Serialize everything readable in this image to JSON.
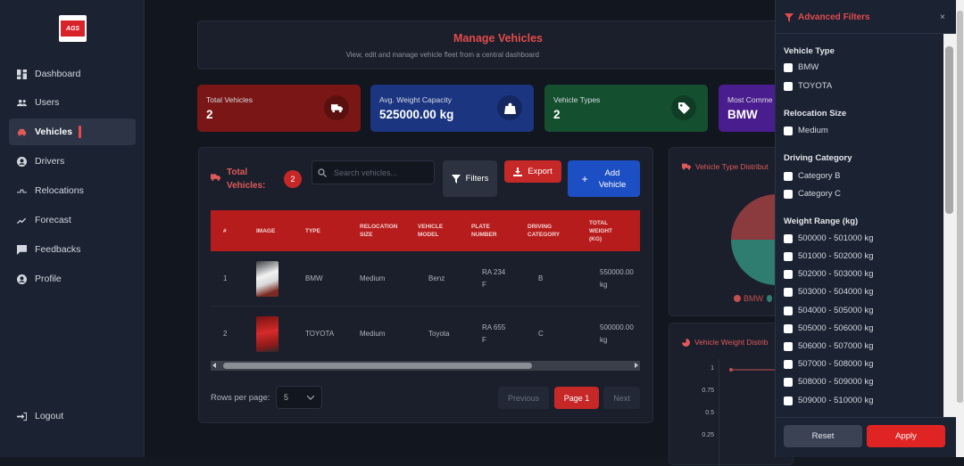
{
  "brand": {
    "logo_text": "AGS"
  },
  "sidebar": {
    "items": [
      {
        "label": "Dashboard",
        "icon": "dashboard-icon"
      },
      {
        "label": "Users",
        "icon": "users-icon"
      },
      {
        "label": "Vehicles",
        "icon": "car-icon"
      },
      {
        "label": "Drivers",
        "icon": "user-circle-icon"
      },
      {
        "label": "Relocations",
        "icon": "route-icon"
      },
      {
        "label": "Forecast",
        "icon": "trend-icon"
      },
      {
        "label": "Feedbacks",
        "icon": "comment-icon"
      },
      {
        "label": "Profile",
        "icon": "profile-icon"
      }
    ],
    "logout": "Logout"
  },
  "header": {
    "title": "Manage Vehicles",
    "subtitle": "View, edit and manage vehicle fleet from a central dashboard"
  },
  "stats": [
    {
      "label": "Total Vehicles",
      "value": "2",
      "color": "#7f1d1d"
    },
    {
      "label": "Avg. Weight Capacity",
      "value": "525000.00 kg",
      "color": "#1e3a8a"
    },
    {
      "label": "Vehicle Types",
      "value": "2",
      "color": "#14532d"
    },
    {
      "label": "Most Comme",
      "value": "BMW",
      "color": "#4c1d95"
    }
  ],
  "toolbar": {
    "total_label_1": "Total",
    "total_label_2": "Vehicles:",
    "count": "2",
    "search_placeholder": "Search vehicles...",
    "filters": "Filters",
    "export": "Export",
    "add_1": "Add",
    "add_2": "Vehicle"
  },
  "table": {
    "headers": [
      "#",
      "IMAGE",
      "TYPE",
      "RELOCATION SIZE",
      "VEHICLE MODEL",
      "PLATE NUMBER",
      "DRIVING CATEGORY",
      "TOTAL WEIGHT (KG)"
    ],
    "rows": [
      {
        "n": "1",
        "type": "BMW",
        "size": "Medium",
        "model": "Benz",
        "plate_1": "RA 234",
        "plate_2": "F",
        "cat": "B",
        "weight_1": "550000.00",
        "weight_2": "kg"
      },
      {
        "n": "2",
        "type": "TOYOTA",
        "size": "Medium",
        "model": "Toyota",
        "plate_1": "RA 655",
        "plate_2": "F",
        "cat": "C",
        "weight_1": "500000.00",
        "weight_2": "kg"
      }
    ]
  },
  "pagination": {
    "rows_label": "Rows per page:",
    "rows_value": "5",
    "prev": "Previous",
    "page": "Page 1",
    "next": "Next"
  },
  "charts": {
    "type_title": "Vehicle Type Distribut",
    "type_legend": "BMW",
    "weight_title": "Vehicle Weight Distrib"
  },
  "chart_data": {
    "type": "line",
    "title": "Vehicle Weight Distrib",
    "yticks": [
      "1",
      "0.75",
      "0.5",
      "0.25"
    ],
    "ylim": [
      0,
      1
    ],
    "series": [
      {
        "values": [
          1,
          1
        ]
      }
    ]
  },
  "filters": {
    "title": "Advanced Filters",
    "close": "×",
    "vehicle_type": {
      "label": "Vehicle Type",
      "options": [
        "BMW",
        "TOYOTA"
      ]
    },
    "relocation_size": {
      "label": "Relocation Size",
      "options": [
        "Medium"
      ]
    },
    "driving_category": {
      "label": "Driving Category",
      "options": [
        "Category B",
        "Category C"
      ]
    },
    "weight_range": {
      "label": "Weight Range (kg)",
      "options": [
        "500000 - 501000 kg",
        "501000 - 502000 kg",
        "502000 - 503000 kg",
        "503000 - 504000 kg",
        "504000 - 505000 kg",
        "505000 - 506000 kg",
        "506000 - 507000 kg",
        "507000 - 508000 kg",
        "508000 - 509000 kg",
        "509000 - 510000 kg"
      ]
    },
    "reset": "Reset",
    "apply": "Apply"
  }
}
